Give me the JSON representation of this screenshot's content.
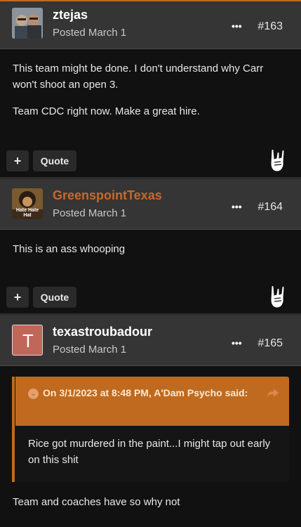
{
  "posts": [
    {
      "author": "ztejas",
      "posted": "Posted March 1",
      "more": "•••",
      "number": "#163",
      "paragraphs": [
        "This team might be done. I don't understand why Carr won't shoot an open 3.",
        "Team CDC right now. Make a great hire."
      ],
      "plus_label": "+",
      "quote_label": "Quote"
    },
    {
      "author": "GreenspointTexas",
      "author_color": "#c8692a",
      "avatar_text": "Hate Hate Hat",
      "posted": "Posted March 1",
      "more": "•••",
      "number": "#164",
      "paragraphs": [
        "This is an ass whooping"
      ],
      "plus_label": "+",
      "quote_label": "Quote"
    },
    {
      "author": "texastroubadour",
      "avatar_letter": "T",
      "avatar_color": "#c0675a",
      "posted": "Posted March 1",
      "more": "•••",
      "number": "#165",
      "quote": {
        "title": "On 3/1/2023 at 8:48 PM, A'Dam Psycho said:",
        "body": "Rice got murdered in the paint...I might tap out early on this shit"
      },
      "paragraphs": [
        "Team and coaches have so why not"
      ]
    }
  ],
  "colors": {
    "accent": "#bf6a1f",
    "header_bg": "#353535",
    "page_bg": "#111111"
  }
}
